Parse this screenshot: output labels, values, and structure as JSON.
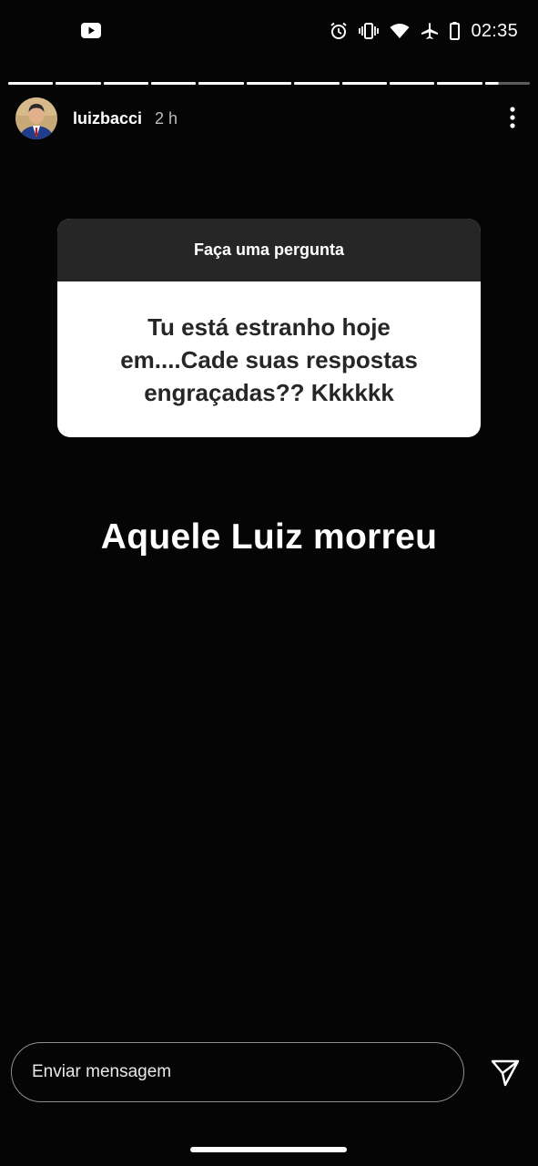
{
  "status_bar": {
    "time": "02:35",
    "icons": [
      "youtube-icon",
      "alarm-icon",
      "vibrate-icon",
      "wifi-icon",
      "airplane-icon",
      "battery-icon"
    ]
  },
  "story": {
    "segments_total": 11,
    "username": "luizbacci",
    "time_ago": "2 h",
    "avatar_icon": "profile-photo",
    "more_icon": "more-vertical-icon"
  },
  "question": {
    "title": "Faça uma pergunta",
    "text": "Tu está estranho hoje em....Cade suas respostas engraçadas?? Kkkkkk"
  },
  "reply": {
    "text": "Aquele Luiz morreu"
  },
  "message_bar": {
    "placeholder": "Enviar mensagem",
    "value": "",
    "send_icon": "send-icon"
  },
  "colors": {
    "background": "#050505",
    "card_header": "#262626",
    "card_body": "#ffffff",
    "card_text": "#262626"
  }
}
